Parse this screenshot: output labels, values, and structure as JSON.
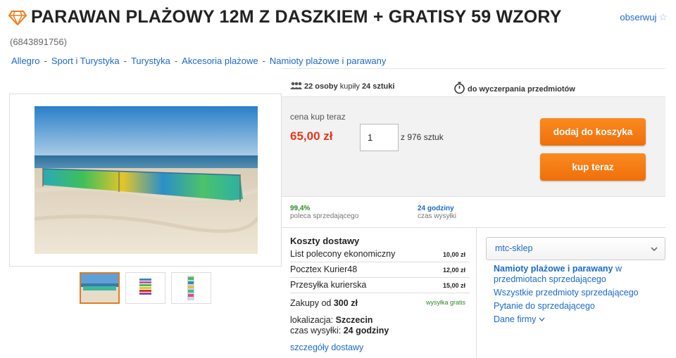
{
  "header": {
    "title": "PARAWAN PLAŻOWY 12M Z DASZKIEM + GRATISY 59 WZORY",
    "observe_label": "obserwuj",
    "offer_id": "(6843891756)"
  },
  "breadcrumb": [
    "Allegro",
    "Sport i Turystyka",
    "Turystyka",
    "Akcesoria plażowe",
    "Namioty plażowe i parawany"
  ],
  "stats": {
    "buyers_count": "22 osoby",
    "bought_text": "kupiły",
    "bought_qty": "24 sztuki",
    "until_text": "do wyczerpania przedmiotów"
  },
  "buy": {
    "price_label": "cena kup teraz",
    "price": "65,00 zł",
    "quantity": "1",
    "available": "z 976 sztuk",
    "add_to_cart": "dodaj do koszyka",
    "buy_now": "kup teraz"
  },
  "seller_stats": {
    "recommend_value": "99,4%",
    "recommend_label": "poleca sprzedającego",
    "dispatch_value": "24 godziny",
    "dispatch_label": "czas wysyłki"
  },
  "shipping": {
    "title": "Koszty dostawy",
    "options": [
      {
        "name": "List polecony ekonomiczny",
        "price": "10,00 zł"
      },
      {
        "name": "Pocztex Kurier48",
        "price": "12,00 zł"
      },
      {
        "name": "Przesyłka kurierska",
        "price": "15,00 zł"
      }
    ],
    "free_prefix": "Zakupy od",
    "free_amount": "300 zł",
    "free_label": "wysyłka gratis",
    "location_label": "lokalizacja:",
    "location": "Szczecin",
    "dispatch_label": "czas wysyłki:",
    "dispatch": "24 godziny",
    "details_link": "szczegóły dostawy"
  },
  "seller": {
    "name": "mtc-sklep",
    "category_bold": "Namioty plażowe i parawany",
    "category_rest": "w przedmiotach sprzedającego",
    "all_items": "Wszystkie przedmioty sprzedającego",
    "ask": "Pytanie do sprzedającego",
    "company": "Dane firmy"
  },
  "colors": {
    "accent_orange": "#f07a14",
    "price_red": "#e3391a",
    "link_blue": "#1b6ac9",
    "positive_green": "#2a8a25"
  },
  "icons": [
    "diamond-icon",
    "star-icon",
    "people-icon",
    "stopwatch-icon",
    "chevron-down-icon"
  ]
}
